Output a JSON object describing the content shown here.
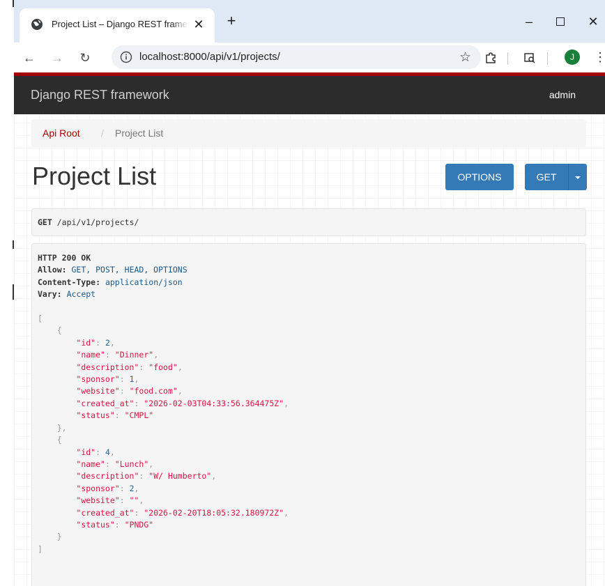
{
  "browser": {
    "tab_title": "Project List – Django REST framework",
    "new_tab_symbol": "+",
    "url": "localhost:8000/api/v1/projects/",
    "profile_initial": "J",
    "colors": {
      "tabstrip": "#dfe8f5",
      "avatar": "#188038"
    }
  },
  "drf": {
    "brand": "Django REST framework",
    "user": "admin",
    "breadcrumbs": [
      "Api Root",
      "Project List"
    ],
    "page_title": "Project List",
    "buttons": {
      "options": "OPTIONS",
      "get": "GET"
    },
    "request": {
      "method": "GET",
      "path": "/api/v1/projects/"
    },
    "response": {
      "status_line": "HTTP 200 OK",
      "headers": [
        {
          "name": "Allow:",
          "value": "GET, POST, HEAD, OPTIONS"
        },
        {
          "name": "Content-Type:",
          "value": "application/json"
        },
        {
          "name": "Vary:",
          "value": "Accept"
        }
      ],
      "projects": [
        {
          "id": "2",
          "name": "\"Dinner\"",
          "description": "\"food\"",
          "sponsor": "1",
          "website": "\"food.com\"",
          "created_at": "\"2026-02-03T04:33:56.364475Z\"",
          "status": "\"CMPL\""
        },
        {
          "id": "4",
          "name": "\"Lunch\"",
          "description": "\"W/ Humberto\"",
          "sponsor": "2",
          "website": "\"\"",
          "created_at": "\"2026-02-20T18:05:32.180972Z\"",
          "status": "\"PNDG\""
        }
      ]
    },
    "colors": {
      "accent": "#a30000",
      "navbar": "#2c2c2c",
      "button": "#337ab7",
      "json_string": "#dd1144"
    }
  }
}
